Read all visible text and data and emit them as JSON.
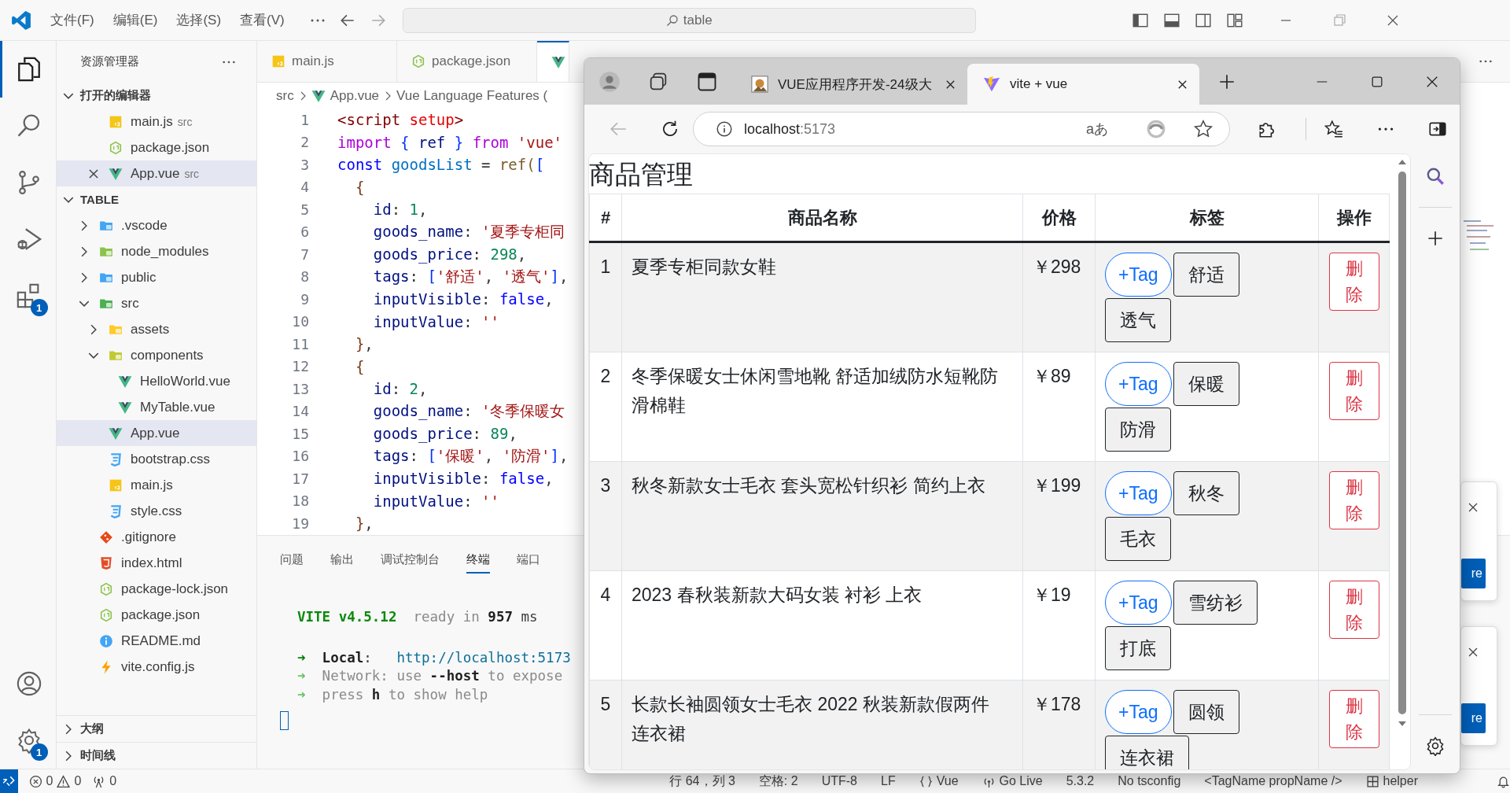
{
  "title_bar": {
    "menus": [
      "文件(F)",
      "编辑(E)",
      "选择(S)",
      "查看(V)"
    ],
    "search": {
      "value": "table"
    }
  },
  "activity_bar": {
    "items": [
      {
        "kind": "explorer",
        "selected": true
      },
      {
        "kind": "search",
        "selected": false
      },
      {
        "kind": "source-control",
        "selected": false
      },
      {
        "kind": "run-debug",
        "selected": false
      },
      {
        "kind": "extensions",
        "selected": false,
        "badge": "1"
      }
    ],
    "bottom": [
      {
        "kind": "account"
      },
      {
        "kind": "manage",
        "badge": "1"
      }
    ]
  },
  "sidebar": {
    "title": "资源管理器",
    "open_editors": {
      "title": "打开的编辑器",
      "expanded": true,
      "items": [
        {
          "name": "main.js",
          "folder": "src",
          "kind": "js",
          "selected": false
        },
        {
          "name": "package.json",
          "kind": "json",
          "selected": false
        },
        {
          "name": "App.vue",
          "folder": "src",
          "kind": "vue",
          "selected": true
        }
      ]
    },
    "project": {
      "title": "TABLE",
      "expanded": true,
      "children": [
        {
          "name": ".vscode",
          "kind": "folder-vscode",
          "expanded": false,
          "selected": false
        },
        {
          "name": "node_modules",
          "kind": "folder-node",
          "expanded": false,
          "selected": false
        },
        {
          "name": "public",
          "kind": "folder-public",
          "expanded": false,
          "selected": false
        },
        {
          "name": "src",
          "kind": "folder-src",
          "expanded": true,
          "selected": false,
          "children": [
            {
              "name": "assets",
              "kind": "folder-assets",
              "expanded": false,
              "selected": false
            },
            {
              "name": "components",
              "kind": "folder-components",
              "expanded": true,
              "selected": false,
              "children": [
                {
                  "name": "HelloWorld.vue",
                  "kind": "vue",
                  "selected": false
                },
                {
                  "name": "MyTable.vue",
                  "kind": "vue",
                  "selected": false
                }
              ]
            },
            {
              "name": "App.vue",
              "kind": "vue",
              "selected": true
            },
            {
              "name": "bootstrap.css",
              "kind": "css",
              "selected": false
            },
            {
              "name": "main.js",
              "kind": "js",
              "selected": false
            },
            {
              "name": "style.css",
              "kind": "css",
              "selected": false
            }
          ]
        },
        {
          "name": ".gitignore",
          "kind": "git",
          "selected": false
        },
        {
          "name": "index.html",
          "kind": "html",
          "selected": false
        },
        {
          "name": "package-lock.json",
          "kind": "json",
          "selected": false
        },
        {
          "name": "package.json",
          "kind": "json",
          "selected": false
        },
        {
          "name": "README.md",
          "kind": "info",
          "selected": false
        },
        {
          "name": "vite.config.js",
          "kind": "vite",
          "selected": false
        }
      ]
    },
    "sections": [
      {
        "title": "大纲",
        "expanded": false
      },
      {
        "title": "时间线",
        "expanded": false
      }
    ]
  },
  "editor": {
    "tabs": [
      {
        "label": "main.js",
        "kind": "js",
        "selected": false
      },
      {
        "label": "package.json",
        "kind": "json",
        "selected": false
      },
      {
        "kind": "vue",
        "selected": true
      }
    ],
    "breadcrumbs": [
      "src",
      "App.vue",
      "Vue Language Features ("
    ],
    "lines": [
      {
        "number": "1",
        "tokens": [
          {
            "kind": "tag",
            "text": "<script"
          },
          {
            "kind": "attr",
            "text": " setup"
          },
          {
            "kind": "tag",
            "text": ">"
          }
        ]
      },
      {
        "number": "2",
        "tokens": [
          {
            "kind": "kw",
            "text": "import"
          },
          {
            "kind": "br",
            "text": " {"
          },
          {
            "kind": "var",
            "text": " ref "
          },
          {
            "kind": "br",
            "text": "}"
          },
          {
            "kind": "kw",
            "text": " from"
          },
          {
            "kind": "str",
            "text": " 'vue'"
          }
        ]
      },
      {
        "number": "3",
        "tokens": [
          {
            "kind": "storage",
            "text": "const"
          },
          {
            "kind": "const",
            "text": " goodsList"
          },
          {
            "kind": "plain",
            "text": " = "
          },
          {
            "kind": "fn",
            "text": "ref("
          },
          {
            "kind": "br",
            "text": "["
          }
        ]
      },
      {
        "number": "4",
        "tokens": [
          {
            "kind": "br3",
            "text": "  {"
          }
        ]
      },
      {
        "number": "5",
        "tokens": [
          {
            "kind": "prop",
            "text": "    id"
          },
          {
            "kind": "plain",
            "text": ": "
          },
          {
            "kind": "num",
            "text": "1"
          },
          {
            "kind": "plain",
            "text": ","
          }
        ]
      },
      {
        "number": "6",
        "tokens": [
          {
            "kind": "prop",
            "text": "    goods_name"
          },
          {
            "kind": "plain",
            "text": ": "
          },
          {
            "kind": "str",
            "text": "'夏季专柜同"
          }
        ]
      },
      {
        "number": "7",
        "tokens": [
          {
            "kind": "prop",
            "text": "    goods_price"
          },
          {
            "kind": "plain",
            "text": ": "
          },
          {
            "kind": "num",
            "text": "298"
          },
          {
            "kind": "plain",
            "text": ","
          }
        ]
      },
      {
        "number": "8",
        "tokens": [
          {
            "kind": "prop",
            "text": "    tags"
          },
          {
            "kind": "plain",
            "text": ": "
          },
          {
            "kind": "br",
            "text": "["
          },
          {
            "kind": "str",
            "text": "'舒适'"
          },
          {
            "kind": "plain",
            "text": ", "
          },
          {
            "kind": "str",
            "text": "'透气'"
          },
          {
            "kind": "br",
            "text": "]"
          },
          {
            "kind": "plain",
            "text": ","
          }
        ]
      },
      {
        "number": "9",
        "tokens": [
          {
            "kind": "prop",
            "text": "    inputVisible"
          },
          {
            "kind": "plain",
            "text": ": "
          },
          {
            "kind": "bool",
            "text": "false"
          },
          {
            "kind": "plain",
            "text": ","
          }
        ]
      },
      {
        "number": "10",
        "tokens": [
          {
            "kind": "prop",
            "text": "    inputValue"
          },
          {
            "kind": "plain",
            "text": ": "
          },
          {
            "kind": "str",
            "text": "''"
          }
        ]
      },
      {
        "number": "11",
        "tokens": [
          {
            "kind": "br3",
            "text": "  }"
          },
          {
            "kind": "plain",
            "text": ","
          }
        ]
      },
      {
        "number": "12",
        "tokens": [
          {
            "kind": "br3",
            "text": "  {"
          }
        ]
      },
      {
        "number": "13",
        "tokens": [
          {
            "kind": "prop",
            "text": "    id"
          },
          {
            "kind": "plain",
            "text": ": "
          },
          {
            "kind": "num",
            "text": "2"
          },
          {
            "kind": "plain",
            "text": ","
          }
        ]
      },
      {
        "number": "14",
        "tokens": [
          {
            "kind": "prop",
            "text": "    goods_name"
          },
          {
            "kind": "plain",
            "text": ": "
          },
          {
            "kind": "str",
            "text": "'冬季保暖女"
          }
        ]
      },
      {
        "number": "15",
        "tokens": [
          {
            "kind": "prop",
            "text": "    goods_price"
          },
          {
            "kind": "plain",
            "text": ": "
          },
          {
            "kind": "num",
            "text": "89"
          },
          {
            "kind": "plain",
            "text": ","
          }
        ]
      },
      {
        "number": "16",
        "tokens": [
          {
            "kind": "prop",
            "text": "    tags"
          },
          {
            "kind": "plain",
            "text": ": "
          },
          {
            "kind": "br",
            "text": "["
          },
          {
            "kind": "str",
            "text": "'保暖'"
          },
          {
            "kind": "plain",
            "text": ", "
          },
          {
            "kind": "str",
            "text": "'防滑'"
          },
          {
            "kind": "br",
            "text": "]"
          },
          {
            "kind": "plain",
            "text": ","
          }
        ]
      },
      {
        "number": "17",
        "tokens": [
          {
            "kind": "prop",
            "text": "    inputVisible"
          },
          {
            "kind": "plain",
            "text": ": "
          },
          {
            "kind": "bool",
            "text": "false"
          },
          {
            "kind": "plain",
            "text": ","
          }
        ]
      },
      {
        "number": "18",
        "tokens": [
          {
            "kind": "prop",
            "text": "    inputValue"
          },
          {
            "kind": "plain",
            "text": ": "
          },
          {
            "kind": "str",
            "text": "''"
          }
        ]
      },
      {
        "number": "19",
        "tokens": [
          {
            "kind": "br3",
            "text": "  }"
          },
          {
            "kind": "plain",
            "text": ","
          }
        ]
      }
    ]
  },
  "panel": {
    "tabs": [
      {
        "label": "问题",
        "selected": false
      },
      {
        "label": "输出",
        "selected": false
      },
      {
        "label": "调试控制台",
        "selected": false
      },
      {
        "label": "终端",
        "selected": true
      },
      {
        "label": "端口",
        "selected": false
      }
    ],
    "terminal": [
      [
        [
          {
            "kind": "vite",
            "text": "VITE v4.5.12"
          },
          {
            "kind": "dim",
            "text": "  ready in "
          },
          {
            "kind": "bold",
            "text": "957"
          },
          {
            "kind": "plain",
            "text": " ms"
          }
        ]
      ],
      [
        [
          {
            "kind": "arrow-bold",
            "text": "➜"
          },
          {
            "kind": "bold",
            "text": "  Local"
          },
          {
            "kind": "plain",
            "text": ":   "
          },
          {
            "kind": "link",
            "text": "http://localhost:5173"
          }
        ],
        [
          {
            "kind": "arrow",
            "text": "➜"
          },
          {
            "kind": "dim",
            "text": "  Network: use "
          },
          {
            "kind": "bold",
            "text": "--host"
          },
          {
            "kind": "dim",
            "text": " to expose"
          }
        ],
        [
          {
            "kind": "arrow",
            "text": "➜"
          },
          {
            "kind": "dim",
            "text": "  press "
          },
          {
            "kind": "bold",
            "text": "h"
          },
          {
            "kind": "dim",
            "text": " to show help"
          }
        ]
      ]
    ]
  },
  "status_bar": {
    "errors": "0",
    "warnings": "0",
    "ports": "0",
    "items": [
      {
        "kind": "text",
        "text": "行 64，列 3"
      },
      {
        "kind": "text",
        "text": "空格: 2"
      },
      {
        "kind": "text",
        "text": "UTF-8"
      },
      {
        "kind": "text",
        "text": "LF"
      },
      {
        "kind": "language",
        "text": "Vue"
      },
      {
        "kind": "live",
        "text": "Go Live"
      },
      {
        "kind": "text",
        "text": "5.3.2"
      },
      {
        "kind": "text",
        "text": "No tsconfig"
      },
      {
        "kind": "text",
        "text": "<TagName propName />"
      },
      {
        "kind": "helper",
        "text": "helper"
      },
      {
        "kind": "bell"
      }
    ]
  },
  "notifications": [
    {
      "button": "re"
    },
    {
      "button": "re"
    }
  ],
  "browser": {
    "tabs": [
      {
        "title": "VUE应用程序开发-24级大",
        "kind": "page",
        "selected": false
      },
      {
        "title": "vite + vue",
        "kind": "vite",
        "selected": true
      }
    ],
    "address": {
      "host": "localhost",
      "port": ":5173"
    },
    "read_aloud": "aあ",
    "page": {
      "heading": "商品管理",
      "columns": [
        "#",
        "商品名称",
        "价格",
        "标签",
        "操作"
      ],
      "rows": [
        {
          "id": "1",
          "name": "夏季专柜同款女鞋",
          "price": "￥298",
          "add_tag": "+Tag",
          "tags": [
            "舒适",
            "透气"
          ],
          "delete": "删除"
        },
        {
          "id": "2",
          "name": "冬季保暖女士休闲雪地靴 舒适加绒防水短靴防滑棉鞋",
          "price": "￥89",
          "add_tag": "+Tag",
          "tags": [
            "保暖",
            "防滑"
          ],
          "delete": "删除"
        },
        {
          "id": "3",
          "name": "秋冬新款女士毛衣 套头宽松针织衫 简约上衣",
          "price": "￥199",
          "add_tag": "+Tag",
          "tags": [
            "秋冬",
            "毛衣"
          ],
          "delete": "删除"
        },
        {
          "id": "4",
          "name": "2023 春秋装新款大码女装 衬衫 上衣",
          "price": "￥19",
          "add_tag": "+Tag",
          "tags": [
            "雪纺衫",
            "打底"
          ],
          "delete": "删除"
        },
        {
          "id": "5",
          "name": "长款长袖圆领女士毛衣 2022 秋装新款假两件连衣裙",
          "price": "￥178",
          "add_tag": "+Tag",
          "tags": [
            "圆领",
            "连衣裙"
          ],
          "delete": "删除"
        }
      ]
    }
  }
}
